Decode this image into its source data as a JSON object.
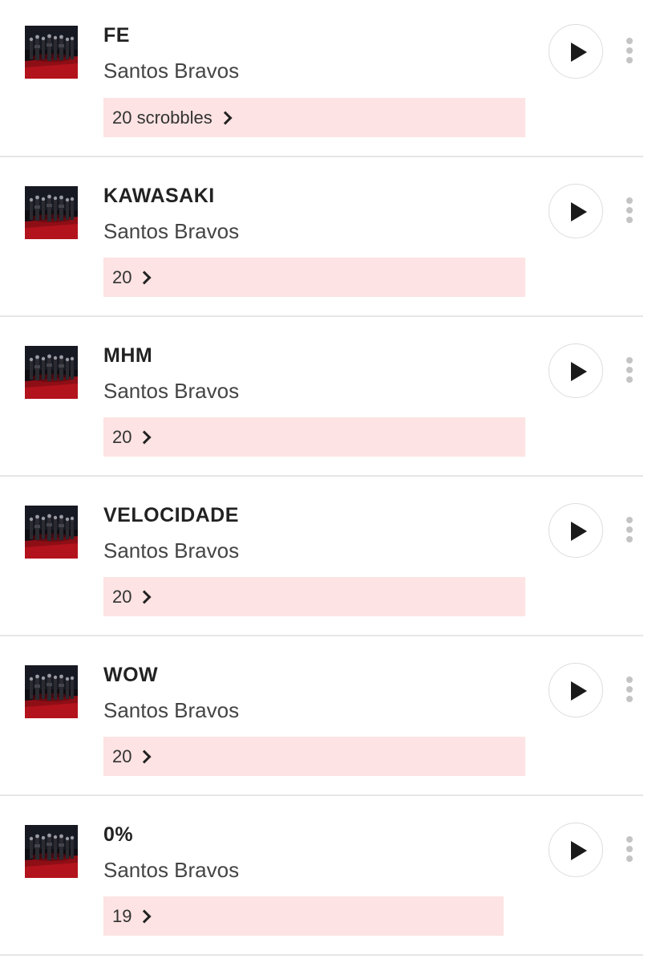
{
  "tracks": [
    {
      "title": "FE",
      "artist": "Santos Bravos",
      "scrobbles": "20 scrobbles"
    },
    {
      "title": "KAWASAKI",
      "artist": "Santos Bravos",
      "scrobbles": "20"
    },
    {
      "title": "MHM",
      "artist": "Santos Bravos",
      "scrobbles": "20"
    },
    {
      "title": "VELOCIDADE",
      "artist": "Santos Bravos",
      "scrobbles": "20"
    },
    {
      "title": "WOW",
      "artist": "Santos Bravos",
      "scrobbles": "20"
    },
    {
      "title": "0%",
      "artist": "Santos Bravos",
      "scrobbles": "19"
    }
  ],
  "icons": {
    "play": "play-icon",
    "more": "more-vertical-icon",
    "chevron": "chevron-right-icon"
  },
  "colors": {
    "scrobble_bar": "#fde3e3",
    "divider": "#e6e6e6",
    "play_icon": "#1a1a1a",
    "more_dots": "#c4c4c4"
  }
}
